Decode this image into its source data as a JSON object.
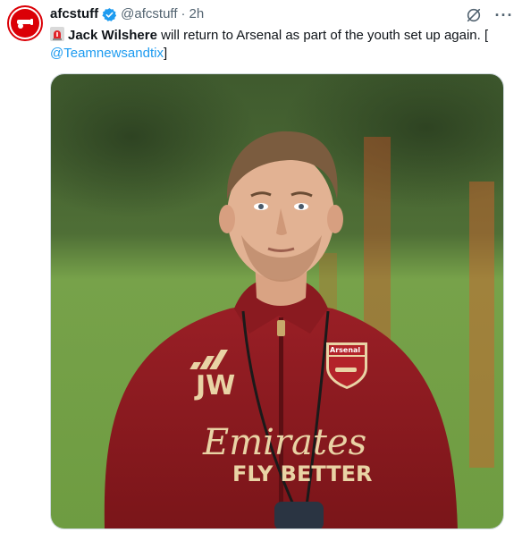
{
  "tweet": {
    "author": {
      "display_name": "afcstuff",
      "handle": "@afcstuff",
      "verified": true,
      "avatar_icon": "arsenal-cannon-icon"
    },
    "separator": "·",
    "time": "2h",
    "text": {
      "emoji_icon": "siren-icon",
      "bold_name": "Jack Wilshere",
      "rest": " will return to Arsenal as part of the youth set up again. [",
      "mention": "@Teamnewsandtix",
      "close": "]"
    },
    "media": {
      "badge_text": "Arsenal",
      "initials": "JW",
      "sponsor_line1": "Emirates",
      "sponsor_line2": "FLY BETTER"
    },
    "actions": {
      "grok_icon": "grok-icon",
      "more_icon": "more-icon",
      "more_label": "···"
    }
  },
  "colors": {
    "accent": "#1d9bf0",
    "text_primary": "#0f1419",
    "text_secondary": "#536471",
    "brand_red": "#db0007",
    "shirt_red": "#8b1a1f"
  }
}
